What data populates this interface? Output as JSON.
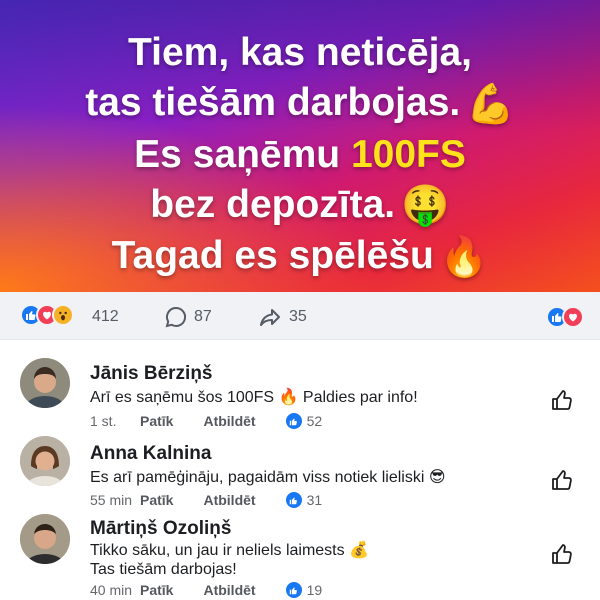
{
  "hero": {
    "line1": "Tiem, kas neticēja,",
    "line2": "tas tiešām darbojas.",
    "line3_prefix": "Es saņēmu",
    "line3_highlight": "100FS",
    "line4": "bez depozīta.",
    "line5": "Tagad es spēlēšu",
    "emoji_line2": "💪",
    "emoji_line4": "🤑",
    "emoji_line5": "🔥",
    "highlight_color": "#ffe21a"
  },
  "reactions": {
    "icons": [
      "like-icon",
      "love-icon",
      "wow-icon"
    ],
    "reaction_count": "412",
    "comment_count": "87",
    "share_count": "35"
  },
  "comments": [
    {
      "name": "Jānis Bērziņš",
      "text": "Arī es saņēmu šos 100FS 🔥 Paldies par info!",
      "time": "1 st.",
      "like_label": "Patīk",
      "reply_label": "Atbildēt",
      "likes": "52"
    },
    {
      "name": "Anna Kalnina",
      "text": "Es arī pamēģināju, pagaidām viss notiek lieliski 😎",
      "time": "55 min",
      "like_label": "Patīk",
      "reply_label": "Atbildēt",
      "likes": "31"
    },
    {
      "name": "Mārtiņš Ozoliņš",
      "text_line1": "Tikko sāku, un jau ir neliels laimests 💰",
      "text_line2": "Tas tiešām darbojas!",
      "time": "40 min",
      "like_label": "Patīk",
      "reply_label": "Atbildēt",
      "likes": "19"
    }
  ],
  "colors": {
    "facebook_blue": "#1877f2",
    "love_red": "#f33e58",
    "bar_bg": "#f0f2f5"
  }
}
